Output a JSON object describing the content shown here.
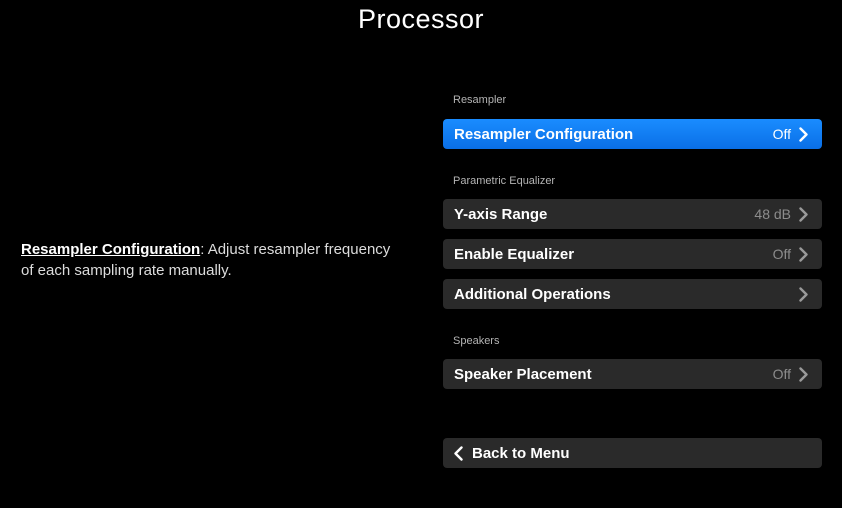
{
  "page": {
    "title": "Processor"
  },
  "description": {
    "term": "Resampler Configuration",
    "separator": ":",
    "text": " Adjust resampler frequency of each sampling rate manually."
  },
  "sections": {
    "resampler": "Resampler",
    "parametric_equalizer": "Parametric Equalizer",
    "speakers": "Speakers"
  },
  "items": {
    "resampler_configuration": {
      "label": "Resampler Configuration",
      "value": "Off",
      "selected": true
    },
    "y_axis_range": {
      "label": "Y-axis Range",
      "value": "48 dB"
    },
    "enable_equalizer": {
      "label": "Enable Equalizer",
      "value": "Off"
    },
    "additional_operations": {
      "label": "Additional Operations",
      "value": ""
    },
    "speaker_placement": {
      "label": "Speaker Placement",
      "value": "Off"
    }
  },
  "back": {
    "label": "Back to Menu",
    "icon": "chevron-left-icon"
  },
  "colors": {
    "background": "#000000",
    "row": "#2a2a2a",
    "selected": "#1a8cff",
    "section_text": "#b4b4b4",
    "value_text": "#8c8c8c"
  }
}
